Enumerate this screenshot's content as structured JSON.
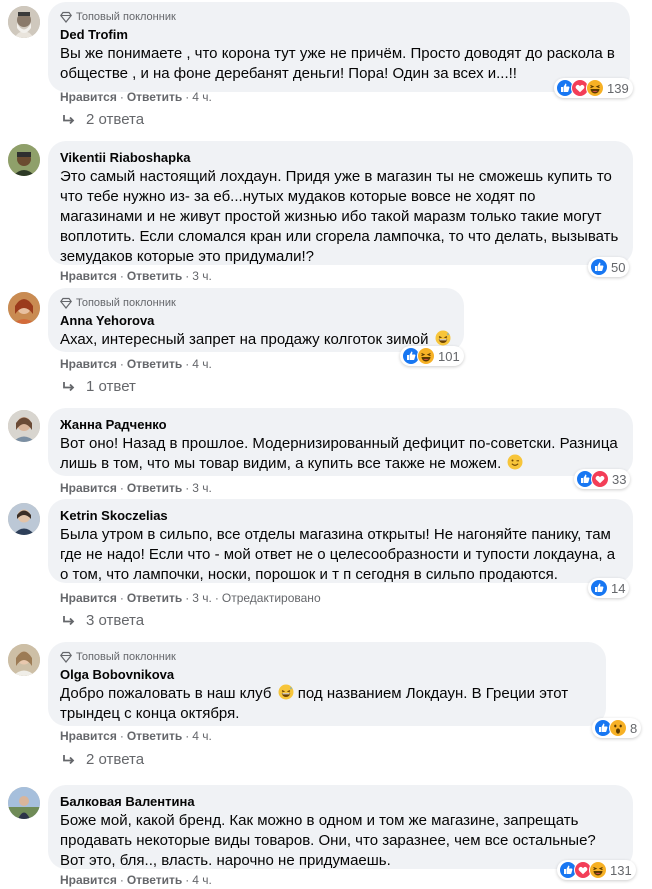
{
  "badge_label": "Топовый поклонник",
  "action_like": "Нравится",
  "action_reply": "Ответить",
  "separator": "·",
  "comments": [
    {
      "author": "Ded Trofim",
      "top_fan": true,
      "text": "Вы же понимаете , что корона тут уже не причём. Просто доводят до раскола в обществе , и на фоне деребанят деньги! Пора! Один за всех и...!!",
      "time": "4 ч.",
      "edited": "",
      "reaction_icons": [
        "like-icon",
        "love-icon",
        "haha-icon"
      ],
      "reaction_count": "139",
      "replies": "2 ответа"
    },
    {
      "author": "Vikentii Riaboshapka",
      "top_fan": false,
      "text": "Это самый настоящий лохдаун. Придя уже в магазин ты не сможешь купить то что тебе нужно из- за еб...нутых мудаков которые вовсе не ходят по магазинами и не живут простой жизнью ибо такой маразм только такие могут воплотить. Если сломался кран или сгорела лампочка, то что делать, вызывать земудаков которые это придумали!?",
      "time": "3 ч.",
      "edited": "",
      "reaction_icons": [
        "like-icon"
      ],
      "reaction_count": "50",
      "replies": ""
    },
    {
      "author": "Anna Yehorova",
      "top_fan": true,
      "text": "Ахах, интересный запрет на продажу колготок зимой",
      "time": "4 ч.",
      "edited": "",
      "reaction_icons": [
        "like-icon",
        "haha-icon"
      ],
      "reaction_count": "101",
      "replies": "1 ответ"
    },
    {
      "author": "Жанна Радченко",
      "top_fan": false,
      "text": "Вот оно! Назад в прошлое. Модернизированный дефицит по-советски. Разница лишь в том, что мы товар видим, а купить все также не можем.",
      "time": "3 ч.",
      "edited": "",
      "reaction_icons": [
        "like-icon",
        "love-icon"
      ],
      "reaction_count": "33",
      "replies": ""
    },
    {
      "author": "Ketrin Skoczelias",
      "top_fan": false,
      "text": "Была утром в сильпо, все отделы магазина открыты! Не нагоняйте панику, там где не надо! Если что - мой ответ не о целесообразности и тупости локдауна, а о том, что лампочки, носки, порошок и т п сегодня в сильпо продаются.",
      "time": "3 ч.",
      "edited": "Отредактировано",
      "reaction_icons": [
        "like-icon"
      ],
      "reaction_count": "14",
      "replies": "3 ответа"
    },
    {
      "author": "Olga Bobovnikova",
      "top_fan": true,
      "text_before": "Добро пожаловать в наш клуб",
      "text_after": "под названием Локдаун. В Греции этот трындец с конца октября.",
      "time": "4 ч.",
      "edited": "",
      "reaction_icons": [
        "like-icon",
        "wow-icon"
      ],
      "reaction_count": "8",
      "replies": "2 ответа"
    },
    {
      "author": "Балковая Валентина",
      "top_fan": false,
      "text": "Боже мой, какой бренд. Как можно в одном и том же магазине, запрещать продавать некоторые виды товаров. Они, что заразнее, чем все остальные? Вот это, бля.., власть. нарочно не придумаешь.",
      "time": "4 ч.",
      "edited": "",
      "reaction_icons": [
        "like-icon",
        "love-icon",
        "haha-icon"
      ],
      "reaction_count": "131",
      "replies": ""
    }
  ]
}
